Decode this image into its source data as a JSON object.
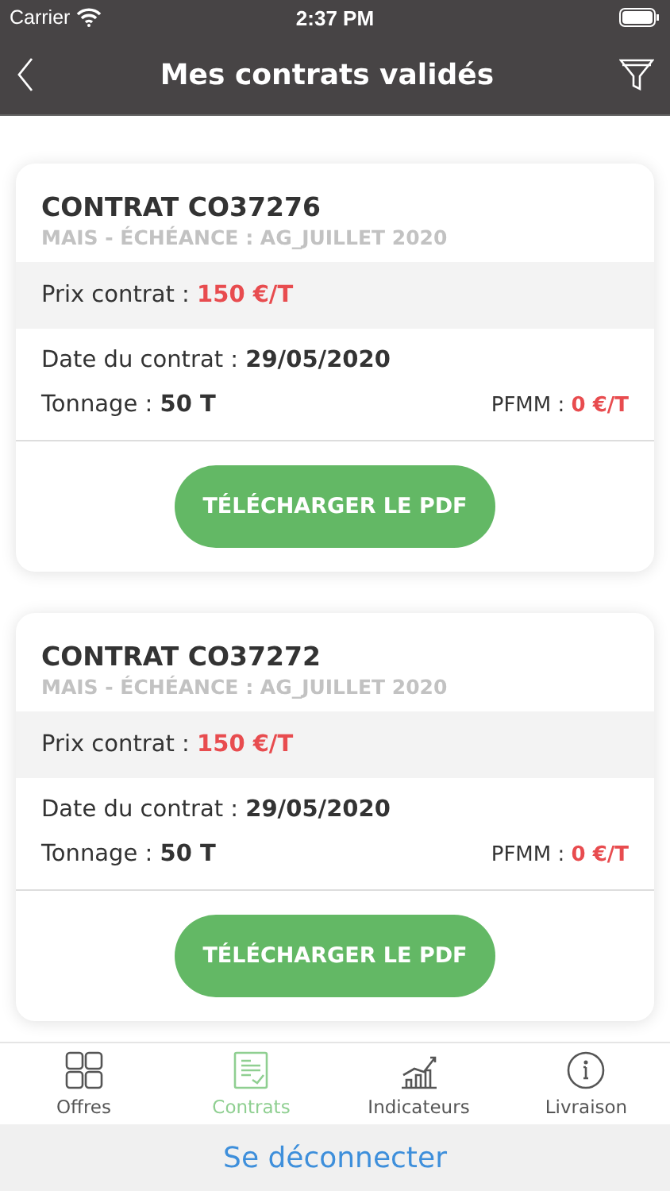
{
  "status_bar": {
    "carrier": "Carrier",
    "time": "2:37 PM"
  },
  "header": {
    "title": "Mes contrats validés"
  },
  "contracts": [
    {
      "title": "CONTRAT CO37276",
      "subtitle": "MAIS - ÉCHÉANCE : AG_JUILLET 2020",
      "price_label": "Prix contrat : ",
      "price": "150 €/T",
      "date_label": "Date du contrat : ",
      "date": "29/05/2020",
      "tonnage_label": "Tonnage : ",
      "tonnage": "50 T",
      "pfmm_label": "PFMM : ",
      "pfmm": "0 €/T",
      "button": "TÉLÉCHARGER LE PDF"
    },
    {
      "title": "CONTRAT CO37272",
      "subtitle": "MAIS - ÉCHÉANCE : AG_JUILLET 2020",
      "price_label": "Prix contrat : ",
      "price": "150 €/T",
      "date_label": "Date du contrat : ",
      "date": "29/05/2020",
      "tonnage_label": "Tonnage : ",
      "tonnage": "50 T",
      "pfmm_label": "PFMM : ",
      "pfmm": "0 €/T",
      "button": "TÉLÉCHARGER LE PDF"
    }
  ],
  "tabs": [
    {
      "label": "Offres",
      "kind": "grid",
      "selected": false
    },
    {
      "label": "Contrats",
      "kind": "doc",
      "selected": true
    },
    {
      "label": "Indicateurs",
      "kind": "chart",
      "selected": false
    },
    {
      "label": "Livraison",
      "kind": "info",
      "selected": false
    }
  ],
  "logout": "Se déconnecter"
}
